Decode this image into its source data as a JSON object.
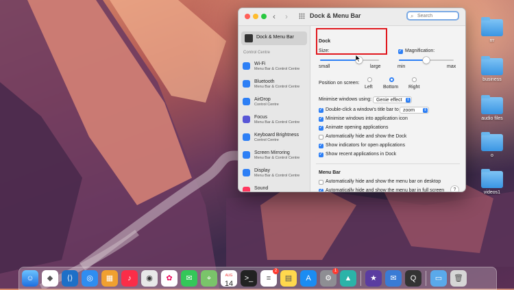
{
  "window": {
    "title": "Dock & Menu Bar",
    "search_placeholder": "Search"
  },
  "sidebar": {
    "selected": "Dock & Menu Bar",
    "section_header": "Control Centre",
    "items": [
      {
        "title": "Wi-Fi",
        "subtitle": "Menu Bar & Control Centre",
        "color": "#2d7ff5",
        "icon": "wifi-icon"
      },
      {
        "title": "Bluetooth",
        "subtitle": "Menu Bar & Control Centre",
        "color": "#2d7ff5",
        "icon": "bluetooth-icon"
      },
      {
        "title": "AirDrop",
        "subtitle": "Control Centre",
        "color": "#2d7ff5",
        "icon": "airdrop-icon"
      },
      {
        "title": "Focus",
        "subtitle": "Menu Bar & Control Centre",
        "color": "#5856d6",
        "icon": "moon-icon"
      },
      {
        "title": "Keyboard Brightness",
        "subtitle": "Control Centre",
        "color": "#2d7ff5",
        "icon": "keyboard-brightness-icon"
      },
      {
        "title": "Screen Mirroring",
        "subtitle": "Menu Bar & Control Centre",
        "color": "#2d7ff5",
        "icon": "screen-mirroring-icon"
      },
      {
        "title": "Display",
        "subtitle": "Menu Bar & Control Centre",
        "color": "#2d7ff5",
        "icon": "display-icon"
      },
      {
        "title": "Sound",
        "subtitle": "",
        "color": "#ff375f",
        "icon": "sound-icon"
      }
    ]
  },
  "dock_section": {
    "header": "Dock",
    "size": {
      "label": "Size:",
      "min": "small",
      "max": "large",
      "value": 0.66
    },
    "magnification": {
      "label": "Magnification:",
      "checked": true,
      "min": "min",
      "max": "max",
      "value": 0.5
    },
    "position": {
      "label": "Position on screen:",
      "options": [
        "Left",
        "Bottom",
        "Right"
      ],
      "selected": "Bottom"
    },
    "minimise": {
      "label": "Minimise windows using:",
      "value": "Genie effect"
    },
    "double_click": {
      "label": "Double-click a window's title bar to",
      "value": "zoom",
      "checked": true
    },
    "checkboxes": [
      {
        "label": "Minimise windows into application icon",
        "checked": true
      },
      {
        "label": "Animate opening applications",
        "checked": true
      },
      {
        "label": "Automatically hide and show the Dock",
        "checked": false
      },
      {
        "label": "Show indicators for open applications",
        "checked": true
      },
      {
        "label": "Show recent applications in Dock",
        "checked": true
      }
    ]
  },
  "menu_bar_section": {
    "header": "Menu Bar",
    "checkboxes": [
      {
        "label": "Automatically hide and show the menu bar on desktop",
        "checked": false
      },
      {
        "label": "Automatically hide and show the menu bar in full screen",
        "checked": true
      }
    ],
    "help": "?"
  },
  "desktop": {
    "folders": [
      "rrr",
      "business",
      "audio files",
      "o",
      "videos1"
    ]
  },
  "dock": {
    "calendar_month": "AUG",
    "calendar_day": "14",
    "badges": {
      "reminders": "2",
      "system_settings": "1"
    }
  },
  "colors": {
    "accent": "#2d7ff5",
    "highlight": "#e0171d"
  }
}
